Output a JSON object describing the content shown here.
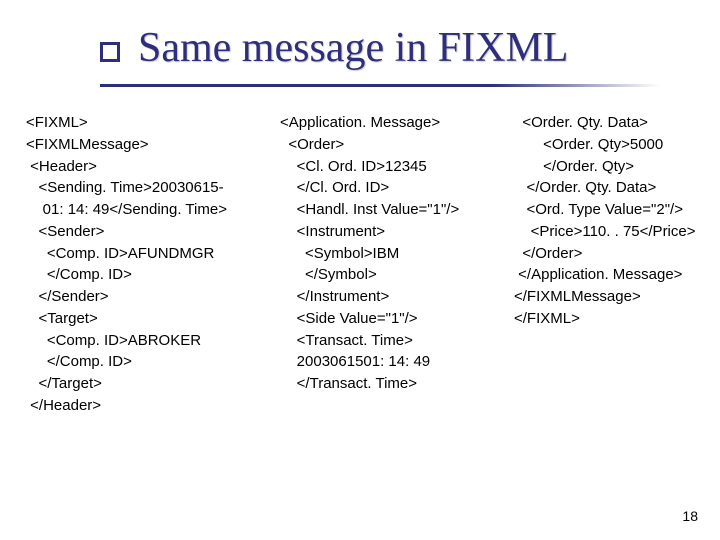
{
  "title": "Same message in FIXML",
  "page_number": "18",
  "columns": {
    "c1": "<FIXML>\n<FIXMLMessage>\n <Header>\n   <Sending. Time>20030615-\n    01: 14: 49</Sending. Time>\n   <Sender>\n     <Comp. ID>AFUNDMGR\n     </Comp. ID>\n   </Sender>\n   <Target>\n     <Comp. ID>ABROKER\n     </Comp. ID>\n   </Target>\n </Header>",
    "c2": "<Application. Message>\n  <Order>\n    <Cl. Ord. ID>12345\n    </Cl. Ord. ID>\n    <Handl. Inst Value=\"1\"/>\n    <Instrument>\n      <Symbol>IBM\n      </Symbol>\n    </Instrument>\n    <Side Value=\"1\"/>\n    <Transact. Time>\n    2003061501: 14: 49\n    </Transact. Time>",
    "c3": "  <Order. Qty. Data>\n       <Order. Qty>5000\n       </Order. Qty>\n   </Order. Qty. Data>\n   <Ord. Type Value=\"2\"/>\n    <Price>110. . 75</Price>\n  </Order>\n </Application. Message>\n</FIXMLMessage>\n</FIXML>"
  }
}
